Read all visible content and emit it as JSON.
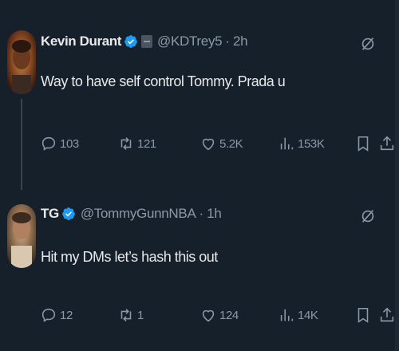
{
  "tweets": [
    {
      "display_name": "Kevin Durant",
      "handle": "@KDTrey5",
      "separator": "·",
      "time": "2h",
      "text": "Way to have self control Tommy. Prada u",
      "stats": {
        "replies": "103",
        "retweets": "121",
        "likes": "5.2K",
        "views": "153K"
      }
    },
    {
      "display_name": "TG",
      "handle": "@TommyGunnNBA",
      "separator": "·",
      "time": "1h",
      "text": "Hit my DMs let’s hash this out",
      "stats": {
        "replies": "12",
        "retweets": "1",
        "likes": "124",
        "views": "14K"
      }
    }
  ],
  "colors": {
    "background": "#16202b",
    "text_primary": "#e7e9ea",
    "text_secondary": "#8b98a5",
    "verified_blue": "#1d9bf0"
  },
  "icons": {
    "reply": "reply-icon",
    "retweet": "retweet-icon",
    "like": "heart-icon",
    "views": "views-icon",
    "bookmark": "bookmark-icon",
    "share": "share-icon",
    "grok": "grok-icon",
    "verified": "verified-badge-icon"
  }
}
